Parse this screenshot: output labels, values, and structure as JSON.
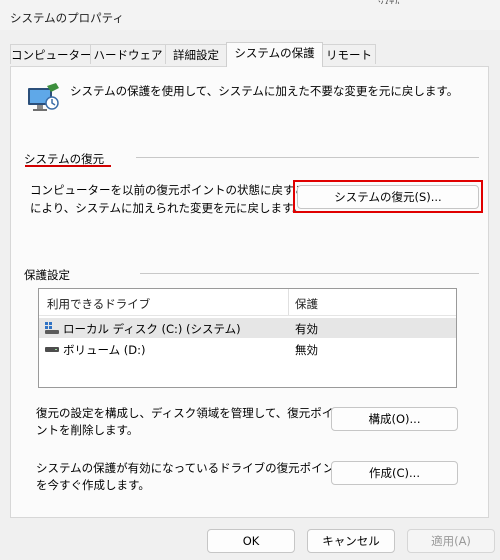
{
  "window": {
    "title": "システムのプロパティ",
    "title_fragment": "ｼｽﾃﾑ"
  },
  "tabs": [
    {
      "label": "コンピューター名"
    },
    {
      "label": "ハードウェア"
    },
    {
      "label": "詳細設定"
    },
    {
      "label": "システムの保護",
      "active": true
    },
    {
      "label": "リモート"
    }
  ],
  "intro": {
    "text": "システムの保護を使用して、システムに加えた不要な変更を元に戻します。",
    "icon": "system-protection-icon"
  },
  "restore": {
    "heading": "システムの復元",
    "description_line1": "コンピューターを以前の復元ポイントの状態に戻すこと",
    "description_line2": "により、システムに加えられた変更を元に戻します。",
    "button_label": "システムの復元(S)..."
  },
  "protection": {
    "heading": "保護設定",
    "columns": {
      "drive": "利用できるドライブ",
      "protection": "保護"
    },
    "drives": [
      {
        "name": "ローカル ディスク (C:) (システム)",
        "status": "有効",
        "icon": "system-drive-icon",
        "selected": true
      },
      {
        "name": "ボリューム (D:)",
        "status": "無効",
        "icon": "drive-icon",
        "selected": false
      }
    ],
    "configure_line1": "復元の設定を構成し、ディスク領域を管理して、復元ポイ",
    "configure_line2": "ントを削除します。",
    "configure_button": "構成(O)...",
    "create_line1": "システムの保護が有効になっているドライブの復元ポイント",
    "create_line2": "を今すぐ作成します。",
    "create_button": "作成(C)..."
  },
  "footer": {
    "ok_label": "OK",
    "cancel_label": "キャンセル",
    "apply_label": "適用(A)"
  },
  "colors": {
    "highlight": "#e00000",
    "accent_underline": "#d10000"
  }
}
